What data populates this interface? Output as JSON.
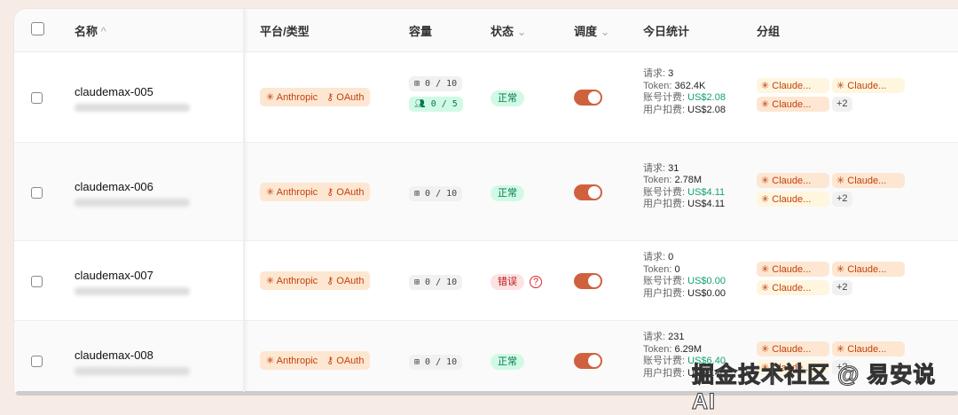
{
  "header": {
    "name": "名称",
    "name_sort": "^",
    "platform": "平台/类型",
    "capacity": "容量",
    "status": "状态",
    "schedule": "调度",
    "today": "今日统计",
    "group": "分组",
    "chev": "⌄"
  },
  "labels": {
    "req": "请求: ",
    "token": "Token: ",
    "acct": "账号计费: ",
    "user": "用户扣费: "
  },
  "rows": [
    {
      "name": "claudemax-005",
      "platform": "Anthropic",
      "type": "OAuth",
      "cap": "0 / 10",
      "cap2": "0 / 5",
      "status": "正常",
      "req": "3",
      "token": "362.4K",
      "acct": "US$2.08",
      "user": "US$2.08",
      "tags": [
        "Claude...",
        "Claude...",
        "Claude..."
      ],
      "more": "+2"
    },
    {
      "name": "claudemax-006",
      "platform": "Anthropic",
      "type": "OAuth",
      "cap": "0 / 10",
      "status": "正常",
      "req": "31",
      "token": "2.78M",
      "acct": "US$4.11",
      "user": "US$4.11",
      "tags": [
        "Claude...",
        "Claude...",
        "Claude..."
      ],
      "more": "+2"
    },
    {
      "name": "claudemax-007",
      "platform": "Anthropic",
      "type": "OAuth",
      "cap": "0 / 10",
      "status": "错误",
      "req": "0",
      "token": "0",
      "acct": "US$0.00",
      "user": "US$0.00",
      "tags": [
        "Claude...",
        "Claude...",
        "Claude..."
      ],
      "more": "+2"
    },
    {
      "name": "claudemax-008",
      "platform": "Anthropic",
      "type": "OAuth",
      "cap": "0 / 10",
      "status": "正常",
      "req": "231",
      "token": "6.29M",
      "acct": "US$6.40",
      "user": "US$6.40",
      "tags": [
        "Claude...",
        "Claude...",
        "Claude..."
      ],
      "more": "+2"
    }
  ],
  "watermark": "掘金技术社区 @ 易安说AI",
  "colors": {
    "accent": "#d0613f",
    "ok": "#047857",
    "err": "#b91c1c"
  }
}
